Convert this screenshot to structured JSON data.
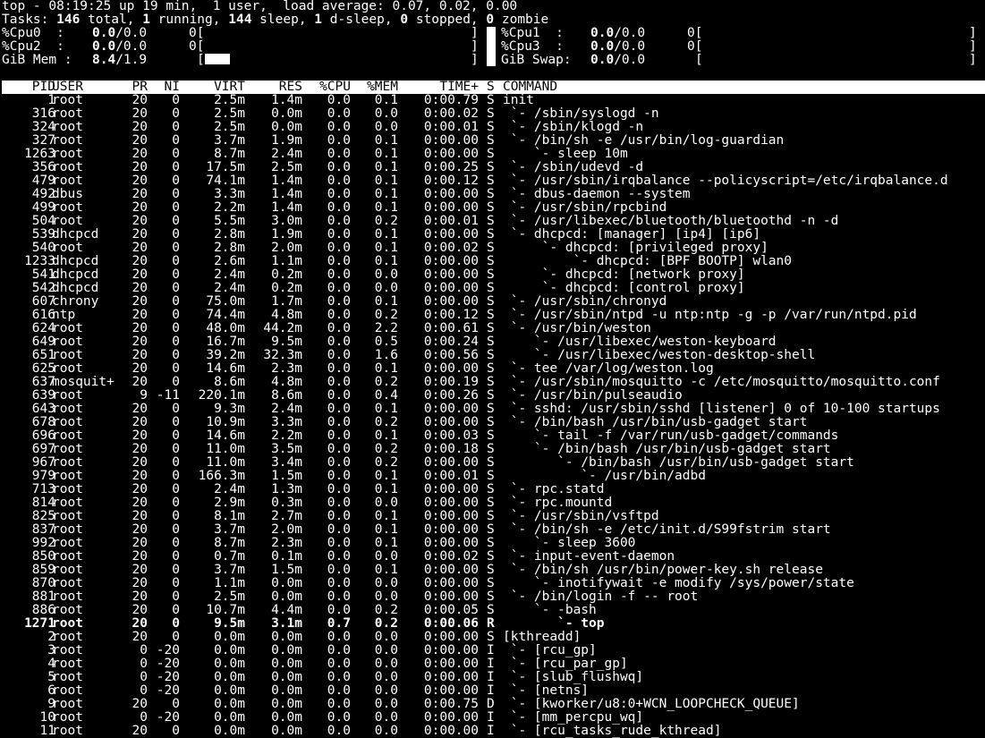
{
  "summary": {
    "uptime_line": "top - 08:19:25 up 19 min,  1 user,  load average: 0.07, 0.02, 0.00",
    "tasks_label": "Tasks:",
    "tasks_total": "146",
    "tasks_total_label": "total,",
    "tasks_running": "1",
    "tasks_running_label": "running,",
    "tasks_sleep": "144",
    "tasks_sleep_label": "sleep,",
    "tasks_dsleep": "1",
    "tasks_dsleep_label": "d-sleep,",
    "tasks_stopped": "0",
    "tasks_stopped_label": "stopped,",
    "tasks_zombie": "0",
    "tasks_zombie_label": "zombie"
  },
  "meters": {
    "cpu0": {
      "label": "%Cpu0  :",
      "value": "0.0",
      "rest": "/0.0",
      "zero": "0[",
      "close": "]"
    },
    "cpu1": {
      "label": "%Cpu1  :",
      "value": "0.0",
      "rest": "/0.0",
      "zero": "0[",
      "close": "]"
    },
    "cpu2": {
      "label": "%Cpu2  :",
      "value": "0.0",
      "rest": "/0.0",
      "zero": "0[",
      "close": "]"
    },
    "cpu3": {
      "label": "%Cpu3  :",
      "value": "0.0",
      "rest": "/0.0",
      "zero": "0[",
      "close": "]"
    },
    "mem": {
      "label": "GiB Mem :",
      "value": "8.4",
      "rest": "/1.9",
      "open": "[",
      "close": "]"
    },
    "swap": {
      "label": "GiB Swap:",
      "value": "0.0",
      "rest": "/0.0",
      "open": "[",
      "close": "]"
    }
  },
  "columns": {
    "pid": "PID",
    "user": "USER",
    "pr": "PR",
    "ni": "NI",
    "virt": "VIRT",
    "res": "RES",
    "cpu": "%CPU",
    "mem": "%MEM",
    "time": "TIME+",
    "s": "S",
    "command": "COMMAND"
  },
  "processes": [
    {
      "pid": "1",
      "user": "root",
      "pr": "20",
      "ni": "0",
      "virt": "2.5m",
      "res": "1.4m",
      "cpu": "0.0",
      "mem": "0.1",
      "time": "0:00.79",
      "s": "S",
      "command": "init"
    },
    {
      "pid": "316",
      "user": "root",
      "pr": "20",
      "ni": "0",
      "virt": "2.5m",
      "res": "0.0m",
      "cpu": "0.0",
      "mem": "0.0",
      "time": "0:00.02",
      "s": "S",
      "command": " `- /sbin/syslogd -n"
    },
    {
      "pid": "324",
      "user": "root",
      "pr": "20",
      "ni": "0",
      "virt": "2.5m",
      "res": "0.0m",
      "cpu": "0.0",
      "mem": "0.0",
      "time": "0:00.01",
      "s": "S",
      "command": " `- /sbin/klogd -n"
    },
    {
      "pid": "327",
      "user": "root",
      "pr": "20",
      "ni": "0",
      "virt": "3.7m",
      "res": "1.9m",
      "cpu": "0.0",
      "mem": "0.1",
      "time": "0:00.00",
      "s": "S",
      "command": " `- /bin/sh -e /usr/bin/log-guardian"
    },
    {
      "pid": "1263",
      "user": "root",
      "pr": "20",
      "ni": "0",
      "virt": "8.7m",
      "res": "2.4m",
      "cpu": "0.0",
      "mem": "0.1",
      "time": "0:00.00",
      "s": "S",
      "command": "    `- sleep 10m"
    },
    {
      "pid": "356",
      "user": "root",
      "pr": "20",
      "ni": "0",
      "virt": "17.5m",
      "res": "2.5m",
      "cpu": "0.0",
      "mem": "0.1",
      "time": "0:00.25",
      "s": "S",
      "command": " `- /sbin/udevd -d"
    },
    {
      "pid": "479",
      "user": "root",
      "pr": "20",
      "ni": "0",
      "virt": "74.1m",
      "res": "1.4m",
      "cpu": "0.0",
      "mem": "0.1",
      "time": "0:00.12",
      "s": "S",
      "command": " `- /usr/sbin/irqbalance --policyscript=/etc/irqbalance.d"
    },
    {
      "pid": "492",
      "user": "dbus",
      "pr": "20",
      "ni": "0",
      "virt": "3.3m",
      "res": "1.4m",
      "cpu": "0.0",
      "mem": "0.1",
      "time": "0:00.00",
      "s": "S",
      "command": " `- dbus-daemon --system"
    },
    {
      "pid": "499",
      "user": "root",
      "pr": "20",
      "ni": "0",
      "virt": "2.2m",
      "res": "1.4m",
      "cpu": "0.0",
      "mem": "0.1",
      "time": "0:00.00",
      "s": "S",
      "command": " `- /usr/sbin/rpcbind"
    },
    {
      "pid": "504",
      "user": "root",
      "pr": "20",
      "ni": "0",
      "virt": "5.5m",
      "res": "3.0m",
      "cpu": "0.0",
      "mem": "0.2",
      "time": "0:00.01",
      "s": "S",
      "command": " `- /usr/libexec/bluetooth/bluetoothd -n -d"
    },
    {
      "pid": "539",
      "user": "dhcpcd",
      "pr": "20",
      "ni": "0",
      "virt": "2.8m",
      "res": "1.9m",
      "cpu": "0.0",
      "mem": "0.1",
      "time": "0:00.00",
      "s": "S",
      "command": " `- dhcpcd: [manager] [ip4] [ip6]"
    },
    {
      "pid": "540",
      "user": "root",
      "pr": "20",
      "ni": "0",
      "virt": "2.8m",
      "res": "2.0m",
      "cpu": "0.0",
      "mem": "0.1",
      "time": "0:00.02",
      "s": "S",
      "command": "     `- dhcpcd: [privileged proxy]"
    },
    {
      "pid": "1233",
      "user": "dhcpcd",
      "pr": "20",
      "ni": "0",
      "virt": "2.6m",
      "res": "1.1m",
      "cpu": "0.0",
      "mem": "0.1",
      "time": "0:00.00",
      "s": "S",
      "command": "         `- dhcpcd: [BPF BOOTP] wlan0"
    },
    {
      "pid": "541",
      "user": "dhcpcd",
      "pr": "20",
      "ni": "0",
      "virt": "2.4m",
      "res": "0.2m",
      "cpu": "0.0",
      "mem": "0.0",
      "time": "0:00.00",
      "s": "S",
      "command": "     `- dhcpcd: [network proxy]"
    },
    {
      "pid": "542",
      "user": "dhcpcd",
      "pr": "20",
      "ni": "0",
      "virt": "2.4m",
      "res": "0.2m",
      "cpu": "0.0",
      "mem": "0.0",
      "time": "0:00.00",
      "s": "S",
      "command": "     `- dhcpcd: [control proxy]"
    },
    {
      "pid": "607",
      "user": "chrony",
      "pr": "20",
      "ni": "0",
      "virt": "75.0m",
      "res": "1.7m",
      "cpu": "0.0",
      "mem": "0.1",
      "time": "0:00.00",
      "s": "S",
      "command": " `- /usr/sbin/chronyd"
    },
    {
      "pid": "616",
      "user": "ntp",
      "pr": "20",
      "ni": "0",
      "virt": "74.4m",
      "res": "4.8m",
      "cpu": "0.0",
      "mem": "0.2",
      "time": "0:00.12",
      "s": "S",
      "command": " `- /usr/sbin/ntpd -u ntp:ntp -g -p /var/run/ntpd.pid"
    },
    {
      "pid": "624",
      "user": "root",
      "pr": "20",
      "ni": "0",
      "virt": "48.0m",
      "res": "44.2m",
      "cpu": "0.0",
      "mem": "2.2",
      "time": "0:00.61",
      "s": "S",
      "command": " `- /usr/bin/weston"
    },
    {
      "pid": "649",
      "user": "root",
      "pr": "20",
      "ni": "0",
      "virt": "16.7m",
      "res": "9.5m",
      "cpu": "0.0",
      "mem": "0.5",
      "time": "0:00.24",
      "s": "S",
      "command": "    `- /usr/libexec/weston-keyboard"
    },
    {
      "pid": "651",
      "user": "root",
      "pr": "20",
      "ni": "0",
      "virt": "39.2m",
      "res": "32.3m",
      "cpu": "0.0",
      "mem": "1.6",
      "time": "0:00.56",
      "s": "S",
      "command": "    `- /usr/libexec/weston-desktop-shell"
    },
    {
      "pid": "625",
      "user": "root",
      "pr": "20",
      "ni": "0",
      "virt": "14.6m",
      "res": "2.3m",
      "cpu": "0.0",
      "mem": "0.1",
      "time": "0:00.00",
      "s": "S",
      "command": " `- tee /var/log/weston.log"
    },
    {
      "pid": "637",
      "user": "mosquit+",
      "pr": "20",
      "ni": "0",
      "virt": "8.6m",
      "res": "4.8m",
      "cpu": "0.0",
      "mem": "0.2",
      "time": "0:00.19",
      "s": "S",
      "command": " `- /usr/sbin/mosquitto -c /etc/mosquitto/mosquitto.conf"
    },
    {
      "pid": "639",
      "user": "root",
      "pr": "9",
      "ni": "-11",
      "virt": "220.1m",
      "res": "8.6m",
      "cpu": "0.0",
      "mem": "0.4",
      "time": "0:00.26",
      "s": "S",
      "command": " `- /usr/bin/pulseaudio"
    },
    {
      "pid": "643",
      "user": "root",
      "pr": "20",
      "ni": "0",
      "virt": "9.3m",
      "res": "2.4m",
      "cpu": "0.0",
      "mem": "0.1",
      "time": "0:00.00",
      "s": "S",
      "command": " `- sshd: /usr/sbin/sshd [listener] 0 of 10-100 startups"
    },
    {
      "pid": "678",
      "user": "root",
      "pr": "20",
      "ni": "0",
      "virt": "10.9m",
      "res": "3.3m",
      "cpu": "0.0",
      "mem": "0.2",
      "time": "0:00.00",
      "s": "S",
      "command": " `- /bin/bash /usr/bin/usb-gadget start"
    },
    {
      "pid": "696",
      "user": "root",
      "pr": "20",
      "ni": "0",
      "virt": "14.6m",
      "res": "2.2m",
      "cpu": "0.0",
      "mem": "0.1",
      "time": "0:00.03",
      "s": "S",
      "command": "    `- tail -f /var/run/usb-gadget/commands"
    },
    {
      "pid": "697",
      "user": "root",
      "pr": "20",
      "ni": "0",
      "virt": "11.0m",
      "res": "3.5m",
      "cpu": "0.0",
      "mem": "0.2",
      "time": "0:00.18",
      "s": "S",
      "command": "    `- /bin/bash /usr/bin/usb-gadget start"
    },
    {
      "pid": "967",
      "user": "root",
      "pr": "20",
      "ni": "0",
      "virt": "11.0m",
      "res": "3.4m",
      "cpu": "0.0",
      "mem": "0.2",
      "time": "0:00.00",
      "s": "S",
      "command": "       `- /bin/bash /usr/bin/usb-gadget start"
    },
    {
      "pid": "979",
      "user": "root",
      "pr": "20",
      "ni": "0",
      "virt": "166.3m",
      "res": "1.5m",
      "cpu": "0.0",
      "mem": "0.1",
      "time": "0:00.01",
      "s": "S",
      "command": "          `- /usr/bin/adbd"
    },
    {
      "pid": "713",
      "user": "root",
      "pr": "20",
      "ni": "0",
      "virt": "2.4m",
      "res": "1.3m",
      "cpu": "0.0",
      "mem": "0.1",
      "time": "0:00.00",
      "s": "S",
      "command": " `- rpc.statd"
    },
    {
      "pid": "814",
      "user": "root",
      "pr": "20",
      "ni": "0",
      "virt": "2.9m",
      "res": "0.3m",
      "cpu": "0.0",
      "mem": "0.0",
      "time": "0:00.00",
      "s": "S",
      "command": " `- rpc.mountd"
    },
    {
      "pid": "825",
      "user": "root",
      "pr": "20",
      "ni": "0",
      "virt": "8.1m",
      "res": "2.7m",
      "cpu": "0.0",
      "mem": "0.1",
      "time": "0:00.00",
      "s": "S",
      "command": " `- /usr/sbin/vsftpd"
    },
    {
      "pid": "837",
      "user": "root",
      "pr": "20",
      "ni": "0",
      "virt": "3.7m",
      "res": "2.0m",
      "cpu": "0.0",
      "mem": "0.1",
      "time": "0:00.00",
      "s": "S",
      "command": " `- /bin/sh -e /etc/init.d/S99fstrim start"
    },
    {
      "pid": "992",
      "user": "root",
      "pr": "20",
      "ni": "0",
      "virt": "8.7m",
      "res": "2.3m",
      "cpu": "0.0",
      "mem": "0.1",
      "time": "0:00.00",
      "s": "S",
      "command": "    `- sleep 3600"
    },
    {
      "pid": "850",
      "user": "root",
      "pr": "20",
      "ni": "0",
      "virt": "0.7m",
      "res": "0.1m",
      "cpu": "0.0",
      "mem": "0.0",
      "time": "0:00.02",
      "s": "S",
      "command": " `- input-event-daemon"
    },
    {
      "pid": "859",
      "user": "root",
      "pr": "20",
      "ni": "0",
      "virt": "3.7m",
      "res": "1.5m",
      "cpu": "0.0",
      "mem": "0.1",
      "time": "0:00.00",
      "s": "S",
      "command": " `- /bin/sh /usr/bin/power-key.sh release"
    },
    {
      "pid": "870",
      "user": "root",
      "pr": "20",
      "ni": "0",
      "virt": "1.1m",
      "res": "0.0m",
      "cpu": "0.0",
      "mem": "0.0",
      "time": "0:00.00",
      "s": "S",
      "command": "    `- inotifywait -e modify /sys/power/state"
    },
    {
      "pid": "881",
      "user": "root",
      "pr": "20",
      "ni": "0",
      "virt": "2.5m",
      "res": "0.0m",
      "cpu": "0.0",
      "mem": "0.0",
      "time": "0:00.00",
      "s": "S",
      "command": " `- /bin/login -f -- root"
    },
    {
      "pid": "886",
      "user": "root",
      "pr": "20",
      "ni": "0",
      "virt": "10.7m",
      "res": "4.4m",
      "cpu": "0.0",
      "mem": "0.2",
      "time": "0:00.05",
      "s": "S",
      "command": "    `- -bash"
    },
    {
      "pid": "1271",
      "user": "root",
      "pr": "20",
      "ni": "0",
      "virt": "9.5m",
      "res": "3.1m",
      "cpu": "0.7",
      "mem": "0.2",
      "time": "0:00.06",
      "s": "R",
      "command": "       `- top",
      "bold": true
    },
    {
      "pid": "2",
      "user": "root",
      "pr": "20",
      "ni": "0",
      "virt": "0.0m",
      "res": "0.0m",
      "cpu": "0.0",
      "mem": "0.0",
      "time": "0:00.00",
      "s": "S",
      "command": "[kthreadd]"
    },
    {
      "pid": "3",
      "user": "root",
      "pr": "0",
      "ni": "-20",
      "virt": "0.0m",
      "res": "0.0m",
      "cpu": "0.0",
      "mem": "0.0",
      "time": "0:00.00",
      "s": "I",
      "command": " `- [rcu_gp]"
    },
    {
      "pid": "4",
      "user": "root",
      "pr": "0",
      "ni": "-20",
      "virt": "0.0m",
      "res": "0.0m",
      "cpu": "0.0",
      "mem": "0.0",
      "time": "0:00.00",
      "s": "I",
      "command": " `- [rcu_par_gp]"
    },
    {
      "pid": "5",
      "user": "root",
      "pr": "0",
      "ni": "-20",
      "virt": "0.0m",
      "res": "0.0m",
      "cpu": "0.0",
      "mem": "0.0",
      "time": "0:00.00",
      "s": "I",
      "command": " `- [slub_flushwq]"
    },
    {
      "pid": "6",
      "user": "root",
      "pr": "0",
      "ni": "-20",
      "virt": "0.0m",
      "res": "0.0m",
      "cpu": "0.0",
      "mem": "0.0",
      "time": "0:00.00",
      "s": "I",
      "command": " `- [netns]"
    },
    {
      "pid": "9",
      "user": "root",
      "pr": "20",
      "ni": "0",
      "virt": "0.0m",
      "res": "0.0m",
      "cpu": "0.0",
      "mem": "0.0",
      "time": "0:00.75",
      "s": "D",
      "command": " `- [kworker/u8:0+WCN_LOOPCHECK_QUEUE]"
    },
    {
      "pid": "10",
      "user": "root",
      "pr": "0",
      "ni": "-20",
      "virt": "0.0m",
      "res": "0.0m",
      "cpu": "0.0",
      "mem": "0.0",
      "time": "0:00.00",
      "s": "I",
      "command": " `- [mm_percpu_wq]"
    },
    {
      "pid": "11",
      "user": "root",
      "pr": "20",
      "ni": "0",
      "virt": "0.0m",
      "res": "0.0m",
      "cpu": "0.0",
      "mem": "0.0",
      "time": "0:00.00",
      "s": "I",
      "command": " `- [rcu_tasks_rude_kthread]"
    }
  ]
}
